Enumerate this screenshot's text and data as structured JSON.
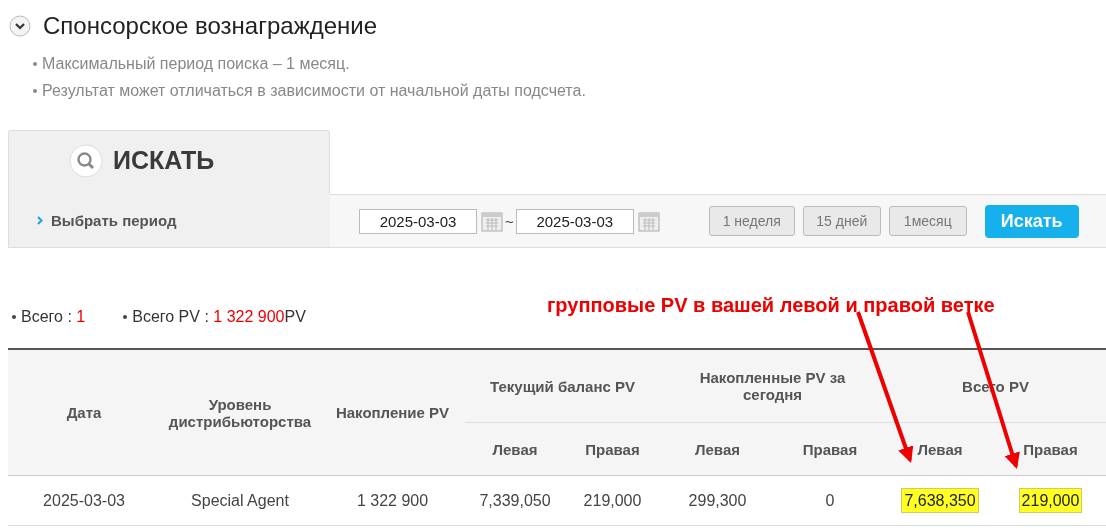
{
  "title": "Спонсорское вознаграждение",
  "notes": [
    "Максимальный период поиска – 1 месяц.",
    "Результат может отличаться в зависимости от начальной даты подсчета."
  ],
  "search_tab": {
    "label": "ИСКАТЬ"
  },
  "period": {
    "label": "Выбрать период",
    "from": "2025-03-03",
    "separator": "~",
    "to": "2025-03-03",
    "presets": [
      "1 неделя",
      "15 дней",
      "1месяц"
    ],
    "search_button": "Искать"
  },
  "summary": [
    {
      "label": "Всего : ",
      "value": "1"
    },
    {
      "label": "Всего PV : ",
      "value": "1 322 900",
      "unit": "PV"
    }
  ],
  "annotation": {
    "text": "групповые PV в вашей левой и правой ветке"
  },
  "table": {
    "header_rows": [
      [
        {
          "text": "Дата",
          "rowspan": 2
        },
        {
          "text": "Уровень дистрибьюторства",
          "rowspan": 2
        },
        {
          "text": "Накопление PV",
          "rowspan": 2
        },
        {
          "text": "Текущий баланс PV",
          "colspan": 2
        },
        {
          "text": "Накопленные PV за сегодня",
          "colspan": 2
        },
        {
          "text": "Всего PV",
          "colspan": 2
        }
      ],
      [
        {
          "text": "Левая"
        },
        {
          "text": "Правая"
        },
        {
          "text": "Левая"
        },
        {
          "text": "Правая"
        },
        {
          "text": "Левая"
        },
        {
          "text": "Правая"
        }
      ]
    ],
    "rows": [
      {
        "cells": [
          {
            "text": "2025-03-03",
            "highlighted": false
          },
          {
            "text": "Special Agent",
            "highlighted": false
          },
          {
            "text": "1 322 900",
            "highlighted": false
          },
          {
            "text": "7,339,050",
            "highlighted": false
          },
          {
            "text": "219,000",
            "highlighted": false
          },
          {
            "text": "299,300",
            "highlighted": false
          },
          {
            "text": "0",
            "highlighted": false
          },
          {
            "text": "7,638,350",
            "highlighted": true
          },
          {
            "text": "219,000",
            "highlighted": true
          }
        ]
      }
    ]
  }
}
